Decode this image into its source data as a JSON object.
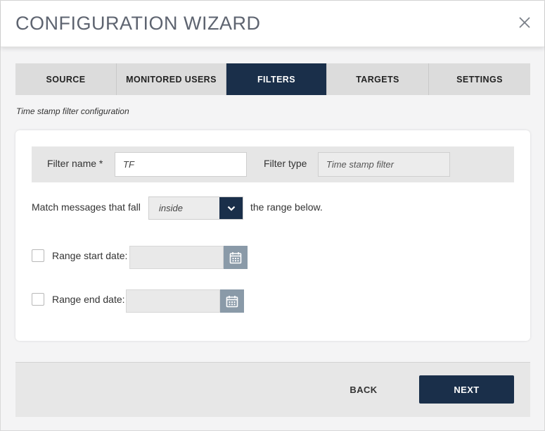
{
  "window": {
    "title": "CONFIGURATION WIZARD",
    "close_icon": "close-icon"
  },
  "tabs": [
    {
      "label": "SOURCE",
      "active": false
    },
    {
      "label": "MONITORED USERS",
      "active": false
    },
    {
      "label": "FILTERS",
      "active": true
    },
    {
      "label": "TARGETS",
      "active": false
    },
    {
      "label": "SETTINGS",
      "active": false
    }
  ],
  "section": {
    "subtitle": "Time stamp filter configuration"
  },
  "filter": {
    "name_label": "Filter name *",
    "name_value": "TF",
    "type_label": "Filter type",
    "type_value": "Time stamp filter"
  },
  "match": {
    "prefix": "Match messages that fall",
    "selected": "inside",
    "suffix": "the range below."
  },
  "range": {
    "start_label": "Range start date:",
    "end_label": "Range end date:",
    "start_value": "",
    "end_value": ""
  },
  "footer": {
    "back_label": "BACK",
    "next_label": "NEXT"
  },
  "colors": {
    "accent": "#1a2f4a",
    "calendar_button": "#8a9aa8"
  }
}
